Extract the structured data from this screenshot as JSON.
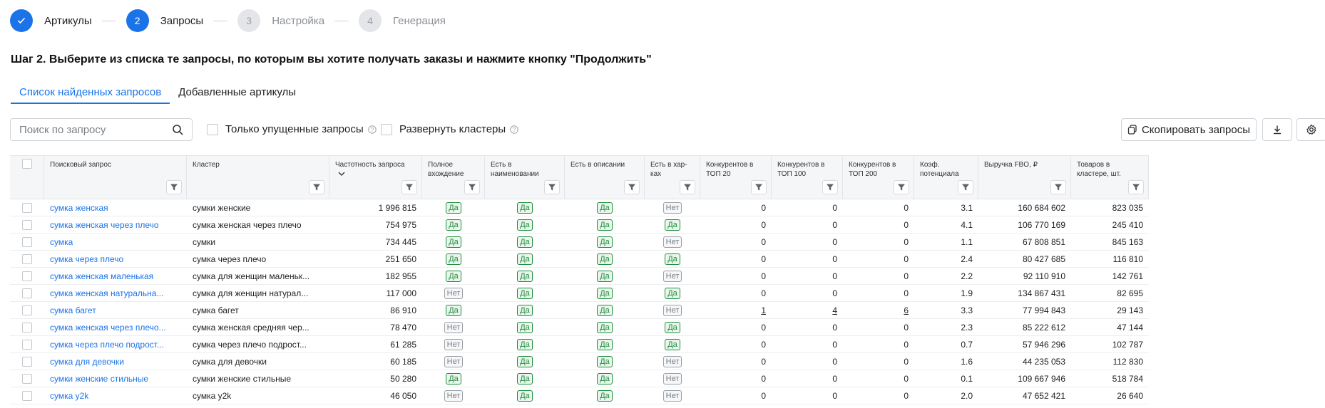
{
  "stepper": [
    {
      "num": "",
      "label": "Артикулы",
      "state": "done"
    },
    {
      "num": "2",
      "label": "Запросы",
      "state": "active"
    },
    {
      "num": "3",
      "label": "Настройка",
      "state": "pending"
    },
    {
      "num": "4",
      "label": "Генерация",
      "state": "pending"
    }
  ],
  "heading": "Шаг 2. Выберите из списка те запросы, по которым вы хотите получать заказы и нажмите кнопку \"Продолжить\"",
  "tabs": {
    "found": "Список найденных запросов",
    "added": "Добавленные артикулы"
  },
  "toolbar": {
    "search_placeholder": "Поиск по запросу",
    "missed_only": "Только упущенные запросы",
    "expand_clusters": "Развернуть кластеры",
    "copy_button": "Скопировать запросы"
  },
  "colors": {
    "accent": "#1a73e8",
    "yes": "#1e8e3e",
    "no": "#9aa0a6"
  },
  "table": {
    "headers": {
      "query": "Поисковый запрос",
      "cluster": "Кластер",
      "frequency": "Частотность запроса",
      "full_match": "Полное вхождение",
      "in_name": "Есть в наименовании",
      "in_description": "Есть в описании",
      "in_specs": "Есть в хар-ках",
      "competitors_20": "Конкурентов в ТОП 20",
      "competitors_100": "Конкурентов в ТОП 100",
      "competitors_200": "Конкурентов в ТОП 200",
      "potential": "Коэф. потенциала",
      "revenue": "Выручка FBO, ₽",
      "items": "Товаров в кластере, шт."
    },
    "rows": [
      {
        "query": "сумка женская",
        "cluster": "сумки женские",
        "frequency": "1 996 815",
        "full": "Да",
        "name": "Да",
        "desc": "Да",
        "specs": "Нет",
        "c20": "0",
        "c100": "0",
        "c200": "0",
        "pot": "3.1",
        "revenue": "160 684 602",
        "items": "823 035"
      },
      {
        "query": "сумка женская через плечо",
        "cluster": "сумка женская через плечо",
        "frequency": "754 975",
        "full": "Да",
        "name": "Да",
        "desc": "Да",
        "specs": "Да",
        "c20": "0",
        "c100": "0",
        "c200": "0",
        "pot": "4.1",
        "revenue": "106 770 169",
        "items": "245 410"
      },
      {
        "query": "сумка",
        "cluster": "сумки",
        "frequency": "734 445",
        "full": "Да",
        "name": "Да",
        "desc": "Да",
        "specs": "Нет",
        "c20": "0",
        "c100": "0",
        "c200": "0",
        "pot": "1.1",
        "revenue": "67 808 851",
        "items": "845 163"
      },
      {
        "query": "сумка через плечо",
        "cluster": "сумка через плечо",
        "frequency": "251 650",
        "full": "Да",
        "name": "Да",
        "desc": "Да",
        "specs": "Да",
        "c20": "0",
        "c100": "0",
        "c200": "0",
        "pot": "2.4",
        "revenue": "80 427 685",
        "items": "116 810"
      },
      {
        "query": "сумка женская маленькая",
        "cluster": "сумка для женщин маленьк...",
        "frequency": "182 955",
        "full": "Да",
        "name": "Да",
        "desc": "Да",
        "specs": "Нет",
        "c20": "0",
        "c100": "0",
        "c200": "0",
        "pot": "2.2",
        "revenue": "92 110 910",
        "items": "142 761"
      },
      {
        "query": "сумка женская натуральна...",
        "cluster": "сумка для женщин натурал...",
        "frequency": "117 000",
        "full": "Нет",
        "name": "Да",
        "desc": "Да",
        "specs": "Да",
        "c20": "0",
        "c100": "0",
        "c200": "0",
        "pot": "1.9",
        "revenue": "134 867 431",
        "items": "82 695"
      },
      {
        "query": "сумка багет",
        "cluster": "сумка багет",
        "frequency": "86 910",
        "full": "Да",
        "name": "Да",
        "desc": "Да",
        "specs": "Нет",
        "c20": "1",
        "c100": "4",
        "c200": "6",
        "pot": "3.3",
        "revenue": "77 994 843",
        "items": "29 143"
      },
      {
        "query": "сумка женская через плечо...",
        "cluster": "сумка женская средняя чер...",
        "frequency": "78 470",
        "full": "Нет",
        "name": "Да",
        "desc": "Да",
        "specs": "Да",
        "c20": "0",
        "c100": "0",
        "c200": "0",
        "pot": "2.3",
        "revenue": "85 222 612",
        "items": "47 144"
      },
      {
        "query": "сумка через плечо подрост...",
        "cluster": "сумка через плечо подрост...",
        "frequency": "61 285",
        "full": "Нет",
        "name": "Да",
        "desc": "Да",
        "specs": "Да",
        "c20": "0",
        "c100": "0",
        "c200": "0",
        "pot": "0.7",
        "revenue": "57 946 296",
        "items": "102 787"
      },
      {
        "query": "сумка для девочки",
        "cluster": "сумка для девочки",
        "frequency": "60 185",
        "full": "Нет",
        "name": "Да",
        "desc": "Да",
        "specs": "Нет",
        "c20": "0",
        "c100": "0",
        "c200": "0",
        "pot": "1.6",
        "revenue": "44 235 053",
        "items": "112 830"
      },
      {
        "query": "сумки женские стильные",
        "cluster": "сумки женские стильные",
        "frequency": "50 280",
        "full": "Да",
        "name": "Да",
        "desc": "Да",
        "specs": "Нет",
        "c20": "0",
        "c100": "0",
        "c200": "0",
        "pot": "0.1",
        "revenue": "109 667 946",
        "items": "518 784"
      },
      {
        "query": "сумка y2k",
        "cluster": "сумка y2k",
        "frequency": "46 050",
        "full": "Нет",
        "name": "Да",
        "desc": "Да",
        "specs": "Нет",
        "c20": "0",
        "c100": "0",
        "c200": "0",
        "pot": "2.0",
        "revenue": "47 652 421",
        "items": "26 640"
      }
    ]
  }
}
